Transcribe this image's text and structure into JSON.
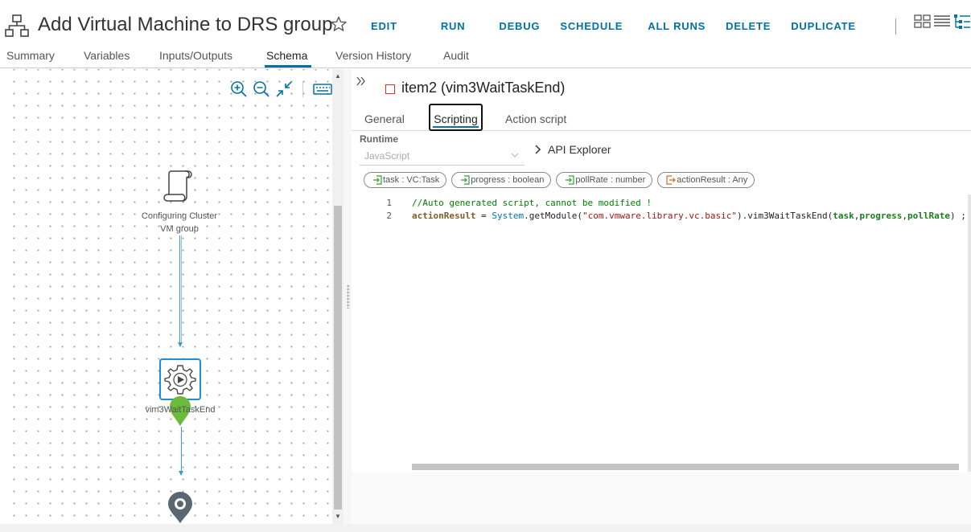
{
  "header": {
    "title": "Add Virtual Machine to DRS group",
    "actions": [
      "EDIT",
      "RUN",
      "DEBUG",
      "SCHEDULE",
      "ALL RUNS",
      "DELETE",
      "DUPLICATE"
    ]
  },
  "tabs": [
    "Summary",
    "Variables",
    "Inputs/Outputs",
    "Schema",
    "Version History",
    "Audit"
  ],
  "active_tab": "Schema",
  "canvas": {
    "nodes": [
      {
        "label_line1": "Configuring Cluster",
        "label_line2": "VM group",
        "icon": "scroll-icon"
      },
      {
        "label": "vim3WaitTaskEnd",
        "icon": "gear-play-icon"
      },
      {
        "icon": "end-pin-icon"
      }
    ]
  },
  "panel": {
    "item_title": "item2 (vim3WaitTaskEnd)",
    "sub_tabs": [
      "General",
      "Scripting",
      "Action script"
    ],
    "active_sub_tab": "Scripting",
    "runtime_label": "Runtime",
    "runtime_value": "JavaScript",
    "api_explorer": "API Explorer",
    "params": [
      "task : VC:Task",
      "progress : boolean",
      "pollRate : number",
      "actionResult : Any"
    ],
    "code": {
      "line1_num": "1",
      "line2_num": "2",
      "line1": "//Auto generated script, cannot be modified !",
      "line2_var": "actionResult",
      "line2_eq": " = ",
      "line2_sys": "System",
      "line2_call": ".getModule(",
      "line2_str": "\"com.vmware.library.vc.basic\"",
      "line2_fn": ").vim3WaitTaskEnd(",
      "line2_a1": "task",
      "line2_c1": ",",
      "line2_a2": "progress",
      "line2_c2": ",",
      "line2_a3": "pollRate",
      "line2_end": ") ;"
    }
  },
  "colors": {
    "accent": "#0072a3",
    "connector": "#3d9ad1",
    "item_marker": "#e4321e",
    "node_green": "#6cbb3c"
  }
}
